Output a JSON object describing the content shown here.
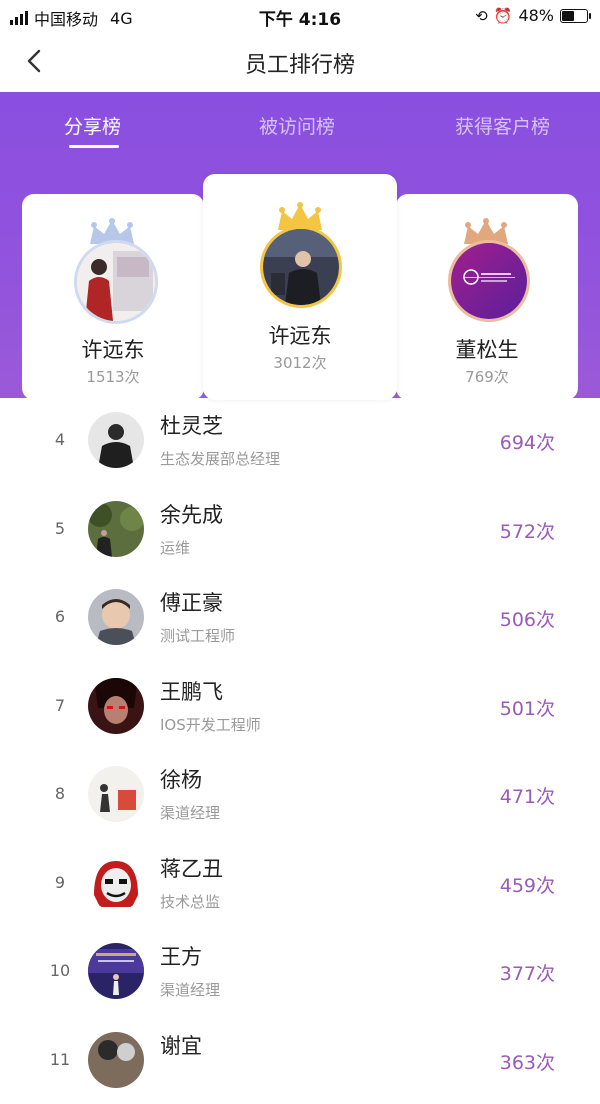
{
  "status_bar": {
    "carrier": "中国移动",
    "network": "4G",
    "time": "下午 4:16",
    "battery": "48%",
    "battery_level": 0.48,
    "icons": [
      "signal-icon",
      "lock-rotation-icon",
      "alarm-icon",
      "battery-icon"
    ]
  },
  "nav": {
    "title": "员工排行榜",
    "back_icon": "chevron-left-icon"
  },
  "colors": {
    "brand_purple": "#8a4fe0",
    "count_purple": "#9a5ab8",
    "crown_gold": "#f4c542",
    "crown_silver": "#b7c7ea",
    "crown_bronze": "#e2a77f"
  },
  "tabs": [
    {
      "label": "分享榜",
      "active": true
    },
    {
      "label": "被访问榜",
      "active": false
    },
    {
      "label": "获得客户榜",
      "active": false
    }
  ],
  "top3": [
    {
      "rank": 2,
      "name": "许远东",
      "count": "1513次",
      "crown": "crown-silver-icon"
    },
    {
      "rank": 1,
      "name": "许远东",
      "count": "3012次",
      "crown": "crown-gold-icon"
    },
    {
      "rank": 3,
      "name": "董松生",
      "count": "769次",
      "crown": "crown-bronze-icon"
    }
  ],
  "list": [
    {
      "rank": "4",
      "name": "杜灵芝",
      "title": "生态发展部总经理",
      "count": "694次"
    },
    {
      "rank": "5",
      "name": "余先成",
      "title": "运维",
      "count": "572次"
    },
    {
      "rank": "6",
      "name": "傅正豪",
      "title": "测试工程师",
      "count": "506次"
    },
    {
      "rank": "7",
      "name": "王鹏飞",
      "title": "IOS开发工程师",
      "count": "501次"
    },
    {
      "rank": "8",
      "name": "徐杨",
      "title": "渠道经理",
      "count": "471次"
    },
    {
      "rank": "9",
      "name": "蒋乙丑",
      "title": "技术总监",
      "count": "459次"
    },
    {
      "rank": "10",
      "name": "王方",
      "title": "渠道经理",
      "count": "377次"
    },
    {
      "rank": "11",
      "name": "谢宜",
      "title": "",
      "count": "363次"
    }
  ]
}
